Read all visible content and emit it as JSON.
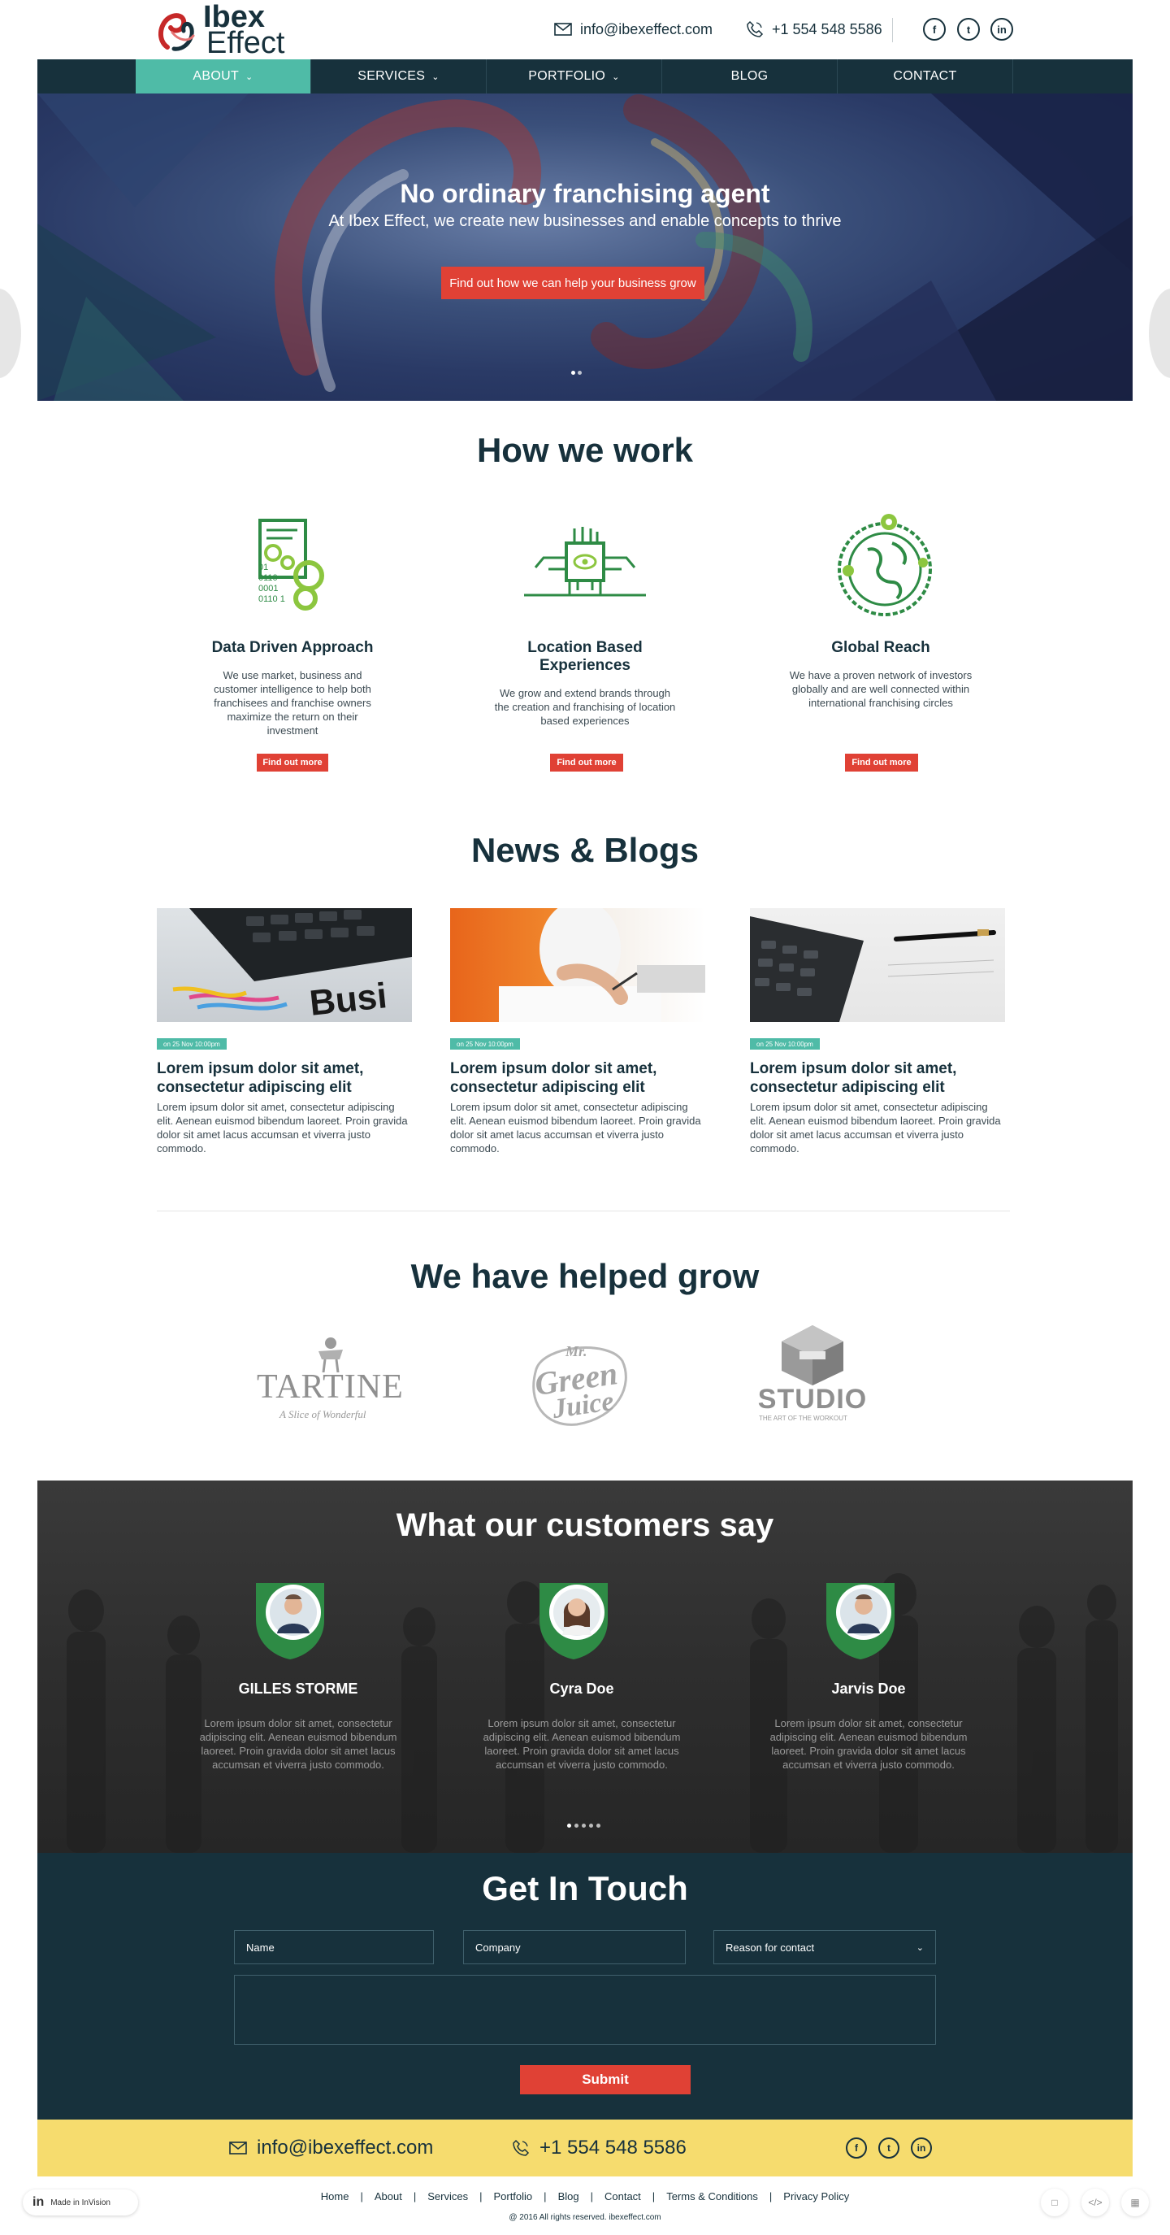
{
  "header": {
    "logo_line1": "Ibex",
    "logo_line2": "Effect",
    "email": "info@ibexeffect.com",
    "phone": "+1 554 548 5586",
    "social": [
      "f",
      "t",
      "in"
    ]
  },
  "nav": {
    "items": [
      {
        "label": "ABOUT",
        "has_dropdown": true,
        "active": true
      },
      {
        "label": "SERVICES",
        "has_dropdown": true,
        "active": false
      },
      {
        "label": "PORTFOLIO",
        "has_dropdown": true,
        "active": false
      },
      {
        "label": "BLOG",
        "has_dropdown": false,
        "active": false
      },
      {
        "label": "CONTACT",
        "has_dropdown": false,
        "active": false
      }
    ]
  },
  "hero": {
    "title": "No ordinary franchising agent",
    "subtitle": "At Ibex Effect, we create new businesses and enable concepts to thrive",
    "cta": "Find out how we can help your business grow",
    "slides": 2
  },
  "how_we_work": {
    "title": "How we work",
    "items": [
      {
        "icon": "data-gears-icon",
        "heading": "Data Driven Approach",
        "text": "We use market, business and customer intelligence to help both franchisees and franchise owners maximize the return on their investment",
        "button": "Find out more",
        "binary": [
          "01",
          "0110",
          "0001",
          "0110 1"
        ]
      },
      {
        "icon": "chip-eye-icon",
        "heading": "Location Based Experiences",
        "text": "We grow and extend brands through the creation and franchising of location based experiences",
        "button": "Find out more"
      },
      {
        "icon": "globe-icon",
        "heading": "Global Reach",
        "text": "We have a proven network of investors globally and are well connected within international franchising circles",
        "button": "Find out more"
      }
    ]
  },
  "news": {
    "title": "News & Blogs",
    "posts": [
      {
        "date": "on 25 Nov 10:00pm",
        "title": "Lorem ipsum dolor sit amet, consectetur adipiscing elit",
        "text": "Lorem ipsum dolor sit amet, consectetur adipiscing elit. Aenean euismod bibendum laoreet. Proin gravida dolor sit amet lacus accumsan et viverra justo commodo.",
        "image_label": "Busi"
      },
      {
        "date": "on 25 Nov 10:00pm",
        "title": "Lorem ipsum dolor sit amet, consectetur adipiscing elit",
        "text": "Lorem ipsum dolor sit amet, consectetur adipiscing elit. Aenean euismod bibendum laoreet. Proin gravida dolor sit amet lacus accumsan et viverra justo commodo."
      },
      {
        "date": "on 25 Nov 10:00pm",
        "title": "Lorem ipsum dolor sit amet, consectetur adipiscing elit",
        "text": "Lorem ipsum dolor sit amet, consectetur adipiscing elit. Aenean euismod bibendum laoreet. Proin gravida dolor sit amet lacus accumsan et viverra justo commodo."
      }
    ]
  },
  "clients": {
    "title": "We have helped grow",
    "logos": [
      {
        "name": "TARTINE",
        "tagline": "A Slice of Wonderful"
      },
      {
        "name": "Mr Green Juice",
        "line1": "Mr.",
        "line2": "Green",
        "line3": "Juice"
      },
      {
        "name": "STUDIO",
        "tagline": "THE ART OF THE WORKOUT"
      }
    ]
  },
  "testimonials": {
    "title": "What our customers say",
    "people": [
      {
        "name": "GILLES STORME",
        "text": "Lorem ipsum dolor sit amet, consectetur adipiscing elit. Aenean euismod bibendum laoreet. Proin gravida dolor sit amet lacus accumsan et viverra justo commodo."
      },
      {
        "name": "Cyra Doe",
        "text": "Lorem ipsum dolor sit amet, consectetur adipiscing elit. Aenean euismod bibendum laoreet. Proin gravida dolor sit amet lacus accumsan et viverra justo commodo."
      },
      {
        "name": "Jarvis Doe",
        "text": "Lorem ipsum dolor sit amet, consectetur adipiscing elit. Aenean euismod bibendum laoreet. Proin gravida dolor sit amet lacus accumsan et viverra justo commodo."
      }
    ],
    "slides": 5
  },
  "contact": {
    "title": "Get In Touch",
    "name_placeholder": "Name",
    "company_placeholder": "Company",
    "reason_placeholder": "Reason for contact",
    "submit": "Submit"
  },
  "footer_bar": {
    "email": "info@ibexeffect.com",
    "phone": "+1 554 548 5586"
  },
  "footer": {
    "links": [
      "Home",
      "About",
      "Services",
      "Portfolio",
      "Blog",
      "Contact",
      "Terms & Conditions",
      "Privacy Policy"
    ],
    "copyright": "@ 2016 All rights reserved. ibexeffect.com"
  },
  "invision": {
    "mark": "in",
    "label": "Made in InVision"
  },
  "colors": {
    "navy": "#17313c",
    "teal": "#4fbba7",
    "red": "#e04135",
    "yellow": "#f6dc6e",
    "green": "#2e8b45",
    "lime": "#8cc63f"
  }
}
